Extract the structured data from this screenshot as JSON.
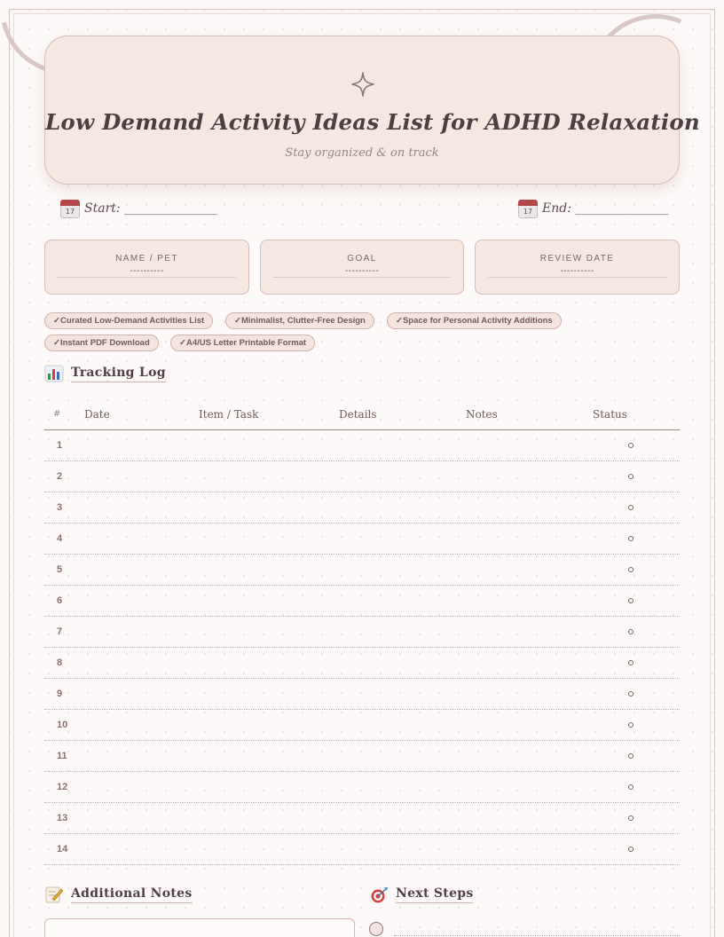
{
  "header": {
    "title": "Low Demand Activity Ideas List for ADHD Relaxation",
    "subtitle": "Stay organized & on track",
    "sparkle_icon": "four-point-star-icon"
  },
  "dates": {
    "calendar_day": "17",
    "start": "Start: _______________",
    "end": "End: _______________"
  },
  "info_cards": [
    {
      "label": "NAME / PET",
      "value": "----------"
    },
    {
      "label": "GOAL",
      "value": "----------"
    },
    {
      "label": "REVIEW DATE",
      "value": "----------"
    }
  ],
  "tags": [
    "✓Curated Low-Demand Activities List",
    "✓Minimalist, Clutter-Free Design",
    "✓Space for Personal Activity Additions",
    "✓Instant PDF Download",
    "✓A4/US Letter Printable Format"
  ],
  "tracking": {
    "title": "Tracking Log",
    "icon": "bar-chart-icon",
    "columns": [
      "#",
      "Date",
      "Item / Task",
      "Details",
      "Notes",
      "Status"
    ],
    "rows": [
      "1",
      "2",
      "3",
      "4",
      "5",
      "6",
      "7",
      "8",
      "9",
      "10",
      "11",
      "12",
      "13",
      "14"
    ]
  },
  "notes": {
    "title": "Additional Notes",
    "icon": "memo-icon"
  },
  "next_steps": {
    "title": "Next Steps",
    "icon": "target-icon"
  },
  "colors": {
    "accent": "#f5e7e1",
    "border": "#d8bcb7",
    "text": "#4d3e41"
  }
}
